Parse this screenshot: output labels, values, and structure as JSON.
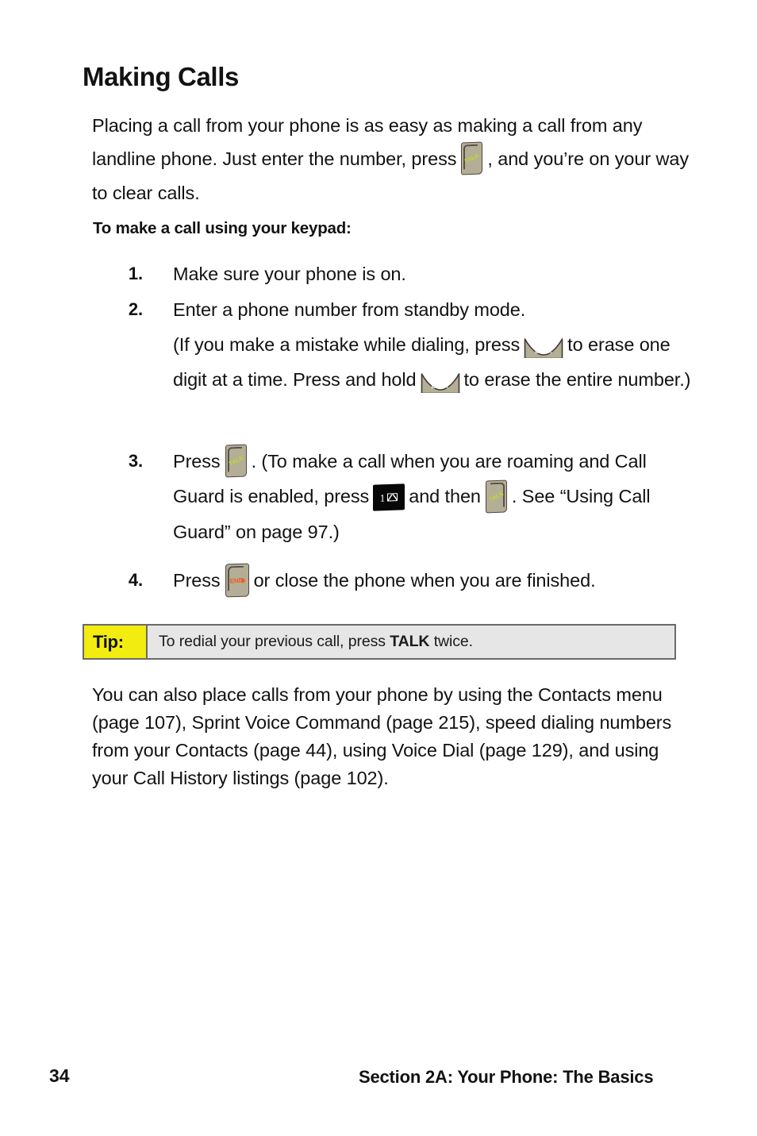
{
  "document": {
    "heading": "Making Calls",
    "intro_part1": "Placing a call from your phone is as easy as making a call from any landline phone. Just enter the number, press",
    "intro_part2": ", and you’re on your way to clear calls.",
    "lead_in": "To make a call using your keypad:",
    "steps": [
      {
        "number": "1.",
        "text": "Make sure your phone is on."
      },
      {
        "number": "2.",
        "text_a": "Enter a phone number from standby mode.",
        "text_b": "(If you make a mistake while dialing, press",
        "text_c": "to erase one digit at a time. Press and hold",
        "text_d": "to erase the entire number.)"
      },
      {
        "number": "3.",
        "text_a": "Press",
        "text_b": ". (To make a call when you are roaming and Call Guard is enabled, press",
        "text_c": "and then",
        "text_d": ". See “Using Call Guard” on page 97.)"
      },
      {
        "number": "4.",
        "text_a": "Press",
        "text_b": "or close the phone when you are finished."
      }
    ],
    "tip": {
      "label": "Tip:",
      "text_before": "To redial your previous call, press",
      "key_name": "TALK",
      "text_after": "twice."
    },
    "closing": "You can also place calls from your phone by using the Contacts menu (page 107), Sprint Voice Command (page 215), speed dialing numbers from your Contacts (page 44), using Voice Dial (page 129), and using your Call History listings (page 102).",
    "footer": {
      "page_number": "34",
      "section": "Section 2A: Your Phone: The Basics"
    },
    "key_icons": {
      "talk_label": "TALK",
      "end_label": "END",
      "end_symbol": "✱",
      "back_label": "BACK",
      "one_digit": "1",
      "one_envelope": "envelope"
    },
    "colors": {
      "key_tan": "#b5ae96",
      "key_black": "#070707",
      "talk_text": "#b9e020",
      "end_text": "#ef5a1e",
      "tip_yellow": "#f2ec10",
      "tip_gray": "#e6e6e6",
      "tip_border": "#6a6a6a",
      "text": "#121212"
    }
  }
}
